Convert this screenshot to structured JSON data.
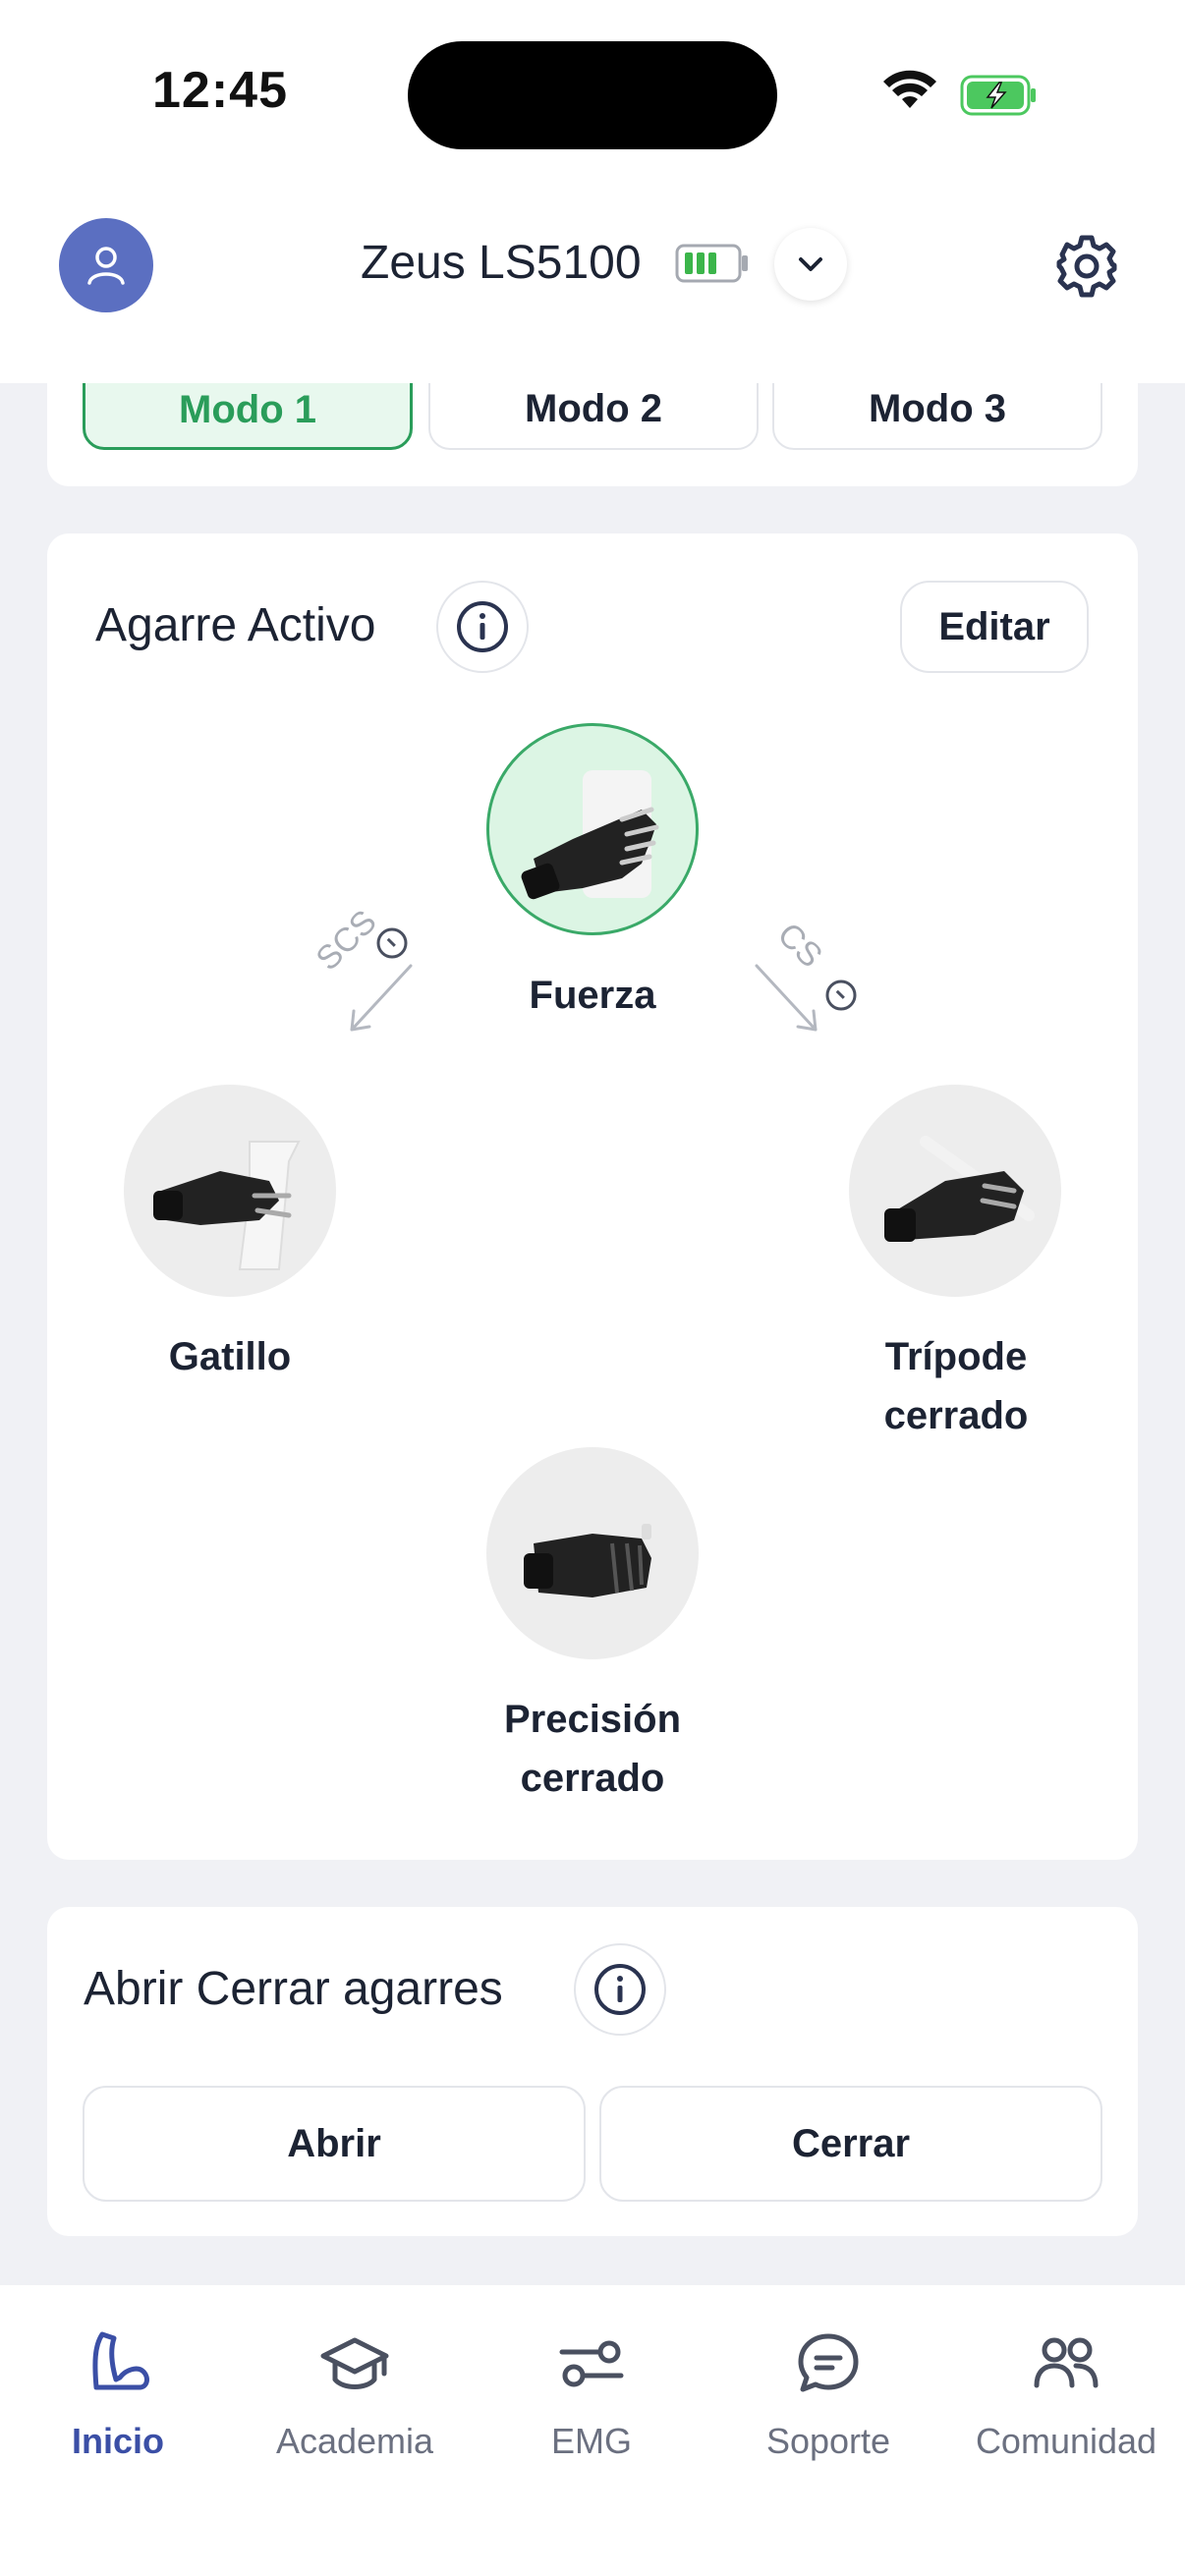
{
  "status_bar": {
    "time": "12:45"
  },
  "header": {
    "device_name": "Zeus LS5100"
  },
  "modes": [
    {
      "label": "Modo 1",
      "active": true
    },
    {
      "label": "Modo 2",
      "active": false
    },
    {
      "label": "Modo 3",
      "active": false
    }
  ],
  "active_grip": {
    "title": "Agarre Activo",
    "edit_label": "Editar",
    "arrows": {
      "left": "SCS",
      "right": "CS"
    },
    "grips": {
      "top": {
        "label": "Fuerza",
        "active": true
      },
      "left": {
        "label": "Gatillo"
      },
      "right": {
        "label_line1": "Trípode",
        "label_line2": "cerrado"
      },
      "bottom": {
        "label_line1": "Precisión",
        "label_line2": "cerrado"
      }
    }
  },
  "open_close": {
    "title": "Abrir Cerrar agarres",
    "open_label": "Abrir",
    "close_label": "Cerrar"
  },
  "nav": {
    "items": [
      {
        "label": "Inicio",
        "icon": "arm-icon",
        "active": true
      },
      {
        "label": "Academia",
        "icon": "graduation-cap-icon"
      },
      {
        "label": "EMG",
        "icon": "sliders-icon"
      },
      {
        "label": "Soporte",
        "icon": "chat-bubble-icon"
      },
      {
        "label": "Comunidad",
        "icon": "people-icon"
      }
    ]
  },
  "colors": {
    "accent_green": "#2a9d5a",
    "accent_blue": "#3b4fa6",
    "avatar_bg": "#5b6fc1"
  }
}
